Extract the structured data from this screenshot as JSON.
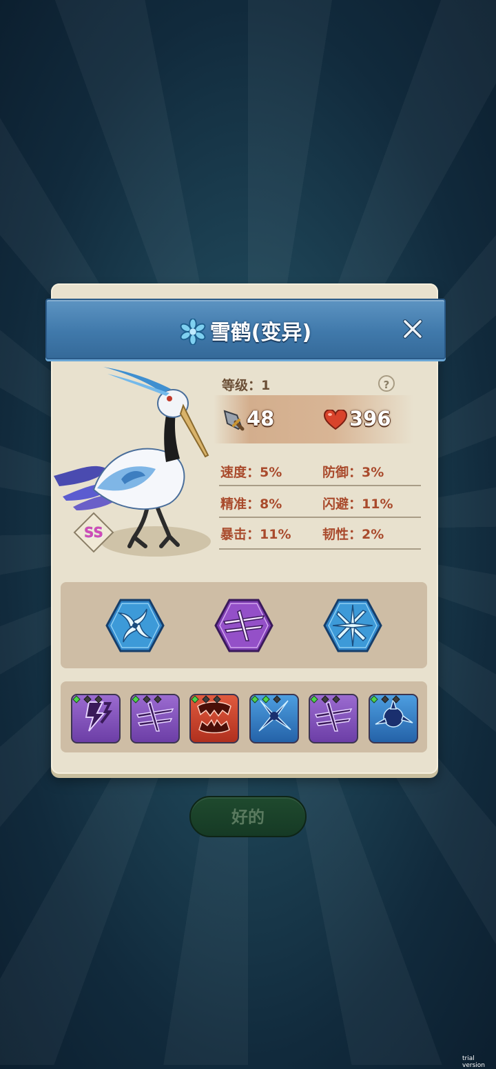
{
  "pet": {
    "name": "雪鹤(变异)",
    "level_text": "等级：1",
    "help_symbol": "?",
    "rank_badge": "SS",
    "attack": "48",
    "hp": "396",
    "attributes": [
      {
        "label": "速度：5%"
      },
      {
        "label": "防御：3%"
      },
      {
        "label": "精准：8%"
      },
      {
        "label": "闪避：11%"
      },
      {
        "label": "暴击：11%"
      },
      {
        "label": "韧性：2%"
      }
    ]
  },
  "skills": [
    {
      "icon": "blue-swirl-skill-icon",
      "color": "#2a7fc4"
    },
    {
      "icon": "purple-slash-skill-icon",
      "color": "#7e3fb3"
    },
    {
      "icon": "blue-cross-skill-icon",
      "color": "#2a7fc4"
    }
  ],
  "genes": [
    {
      "icon": "lightning-gene-icon",
      "color": "#7a4bb0",
      "filled_pips": 1
    },
    {
      "icon": "slash-gene-icon",
      "color": "#7a4bb0",
      "filled_pips": 1
    },
    {
      "icon": "fang-gene-icon",
      "color": "#c0392b",
      "filled_pips": 1
    },
    {
      "icon": "burst-gene-icon",
      "color": "#2e6fb6",
      "filled_pips": 2
    },
    {
      "icon": "slash-gene-icon",
      "color": "#7a4bb0",
      "filled_pips": 1
    },
    {
      "icon": "orb-gene-icon",
      "color": "#2e6fb6",
      "filled_pips": 1
    }
  ],
  "buttons": {
    "ok_label": "好的"
  },
  "watermark": "trial version",
  "colors": {
    "header_blue": "#4079ab",
    "panel_cream": "#e8e1ce",
    "attr_text": "#a94a2c"
  }
}
